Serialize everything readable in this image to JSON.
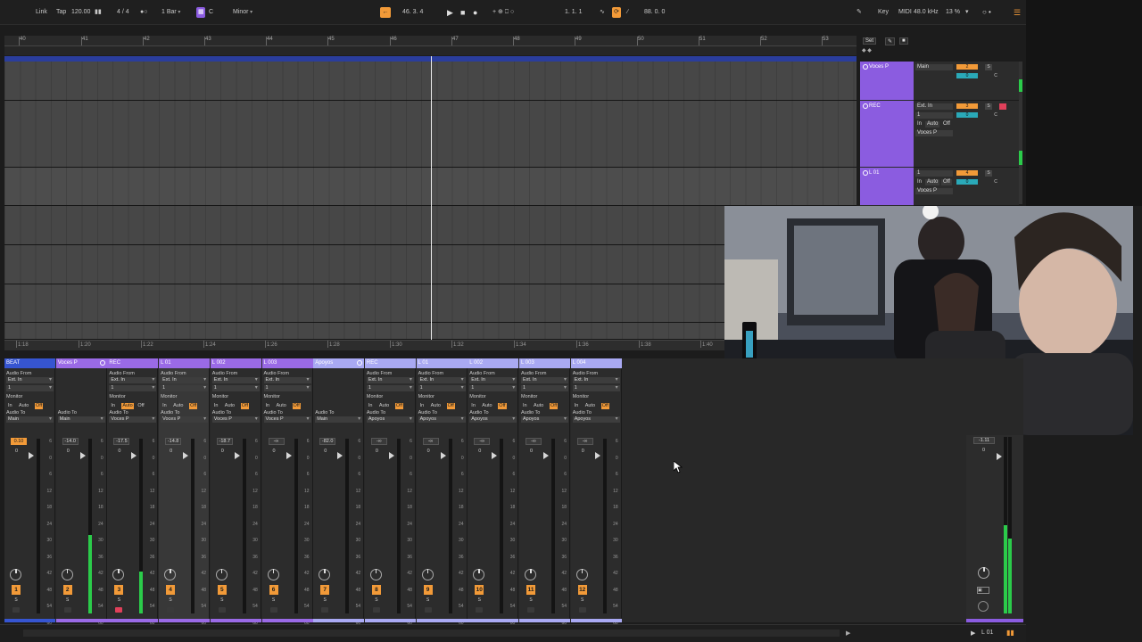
{
  "topbar": {
    "link": "Link",
    "tap": "Tap",
    "tempo": "120.00",
    "time_sig": "4 / 4",
    "quantize": "1 Bar",
    "key_root": "C",
    "scale": "Minor",
    "position": "46.  3.  4",
    "loop_start": "1.  1.  1",
    "loop_length": "88.  0.  0",
    "key_label": "Key",
    "midi_label": "MIDI",
    "sample_rate": "48.0 kHz",
    "cpu": "13 %"
  },
  "ruler": {
    "bars": [
      "40",
      "41",
      "42",
      "43",
      "44",
      "45",
      "46",
      "47",
      "48",
      "49",
      "50",
      "51",
      "52",
      "53"
    ]
  },
  "timeline": {
    "times": [
      "1:18",
      "1:20",
      "1:22",
      "1:24",
      "1:26",
      "1:28",
      "1:30",
      "1:32",
      "1:34",
      "1:36",
      "1:38",
      "1:40"
    ]
  },
  "arrangement": {
    "set_label": "Set",
    "tracks": [
      {
        "name": "Voces P",
        "input": "Main",
        "num": "2",
        "vol": "0",
        "s": "S",
        "c": "C"
      },
      {
        "name": "REC",
        "input": "Ext. In",
        "sub": "1",
        "monitor": [
          "In",
          "Auto",
          "Off"
        ],
        "out": "Voces P",
        "num": "3",
        "vol": "0",
        "s": "S",
        "c": "C"
      },
      {
        "name": "L 01",
        "input": "1",
        "monitor": [
          "In",
          "Auto",
          "Off"
        ],
        "out": "Voces P",
        "num": "4",
        "vol": "0",
        "s": "S",
        "c": "C"
      }
    ]
  },
  "mixer": {
    "labels": {
      "audio_from": "Audio From",
      "monitor": "Monitor",
      "audio_to": "Audio To",
      "in": "In",
      "auto": "Auto",
      "off": "Off",
      "s": "S"
    },
    "strips": [
      {
        "name": "BEAT",
        "color": "#3655d1",
        "from": "Ext. In",
        "ch": "1",
        "to": "Main",
        "vol": "0.10",
        "vol_hot": true,
        "pan": "0",
        "num": "1",
        "level": 0
      },
      {
        "name": "Voces P",
        "color": "#9a6ae6",
        "from": "",
        "ch": "",
        "to": "Main",
        "vol": "-14.0",
        "vol_hot": false,
        "pan": "0",
        "num": "2",
        "level": 0.45
      },
      {
        "name": "REC",
        "color": "#9a6ae6",
        "from": "Ext. In",
        "ch": "1",
        "to": "Voces P",
        "vol": "-17.5",
        "vol_hot": false,
        "pan": "0",
        "num": "3",
        "level": 0.24,
        "armed": true
      },
      {
        "name": "L 01",
        "color": "#9a6ae6",
        "from": "Ext. In",
        "ch": "1",
        "to": "Voces P",
        "vol": "-14.8",
        "vol_hot": false,
        "pan": "0",
        "num": "4",
        "level": 0,
        "selected": true
      },
      {
        "name": "L 002",
        "color": "#9a6ae6",
        "from": "Ext. In",
        "ch": "1",
        "to": "Voces P",
        "vol": "-18.7",
        "vol_hot": false,
        "pan": "0",
        "num": "5",
        "level": 0
      },
      {
        "name": "L 003",
        "color": "#9a6ae6",
        "from": "Ext. In",
        "ch": "1",
        "to": "Voces P",
        "vol": "-∞",
        "vol_hot": false,
        "pan": "0",
        "num": "6",
        "level": 0
      },
      {
        "name": "Apoyos",
        "color": "#a9a9f3",
        "from": "",
        "ch": "",
        "to": "Main",
        "vol": "-82.0",
        "vol_hot": false,
        "pan": "0",
        "num": "7",
        "level": 0
      },
      {
        "name": "REC",
        "color": "#a9a9f3",
        "from": "Ext. In",
        "ch": "1",
        "to": "Apoyos",
        "vol": "-∞",
        "vol_hot": false,
        "pan": "0",
        "num": "8",
        "level": 0
      },
      {
        "name": "L 01",
        "color": "#a9a9f3",
        "from": "Ext. In",
        "ch": "1",
        "to": "Apoyos",
        "vol": "-∞",
        "vol_hot": false,
        "pan": "0",
        "num": "9",
        "level": 0
      },
      {
        "name": "L 002",
        "color": "#a9a9f3",
        "from": "Ext. In",
        "ch": "1",
        "to": "Apoyos",
        "vol": "-∞",
        "vol_hot": false,
        "pan": "0",
        "num": "10",
        "level": 0
      },
      {
        "name": "L 003",
        "color": "#a9a9f3",
        "from": "Ext. In",
        "ch": "1",
        "to": "Apoyos",
        "vol": "-∞",
        "vol_hot": false,
        "pan": "0",
        "num": "11",
        "level": 0
      },
      {
        "name": "L 004",
        "color": "#a9a9f3",
        "from": "Ext. In",
        "ch": "1",
        "to": "Apoyos",
        "vol": "-∞",
        "vol_hot": false,
        "pan": "0",
        "num": "12",
        "level": 0
      }
    ],
    "scale": [
      "6",
      "0",
      "6",
      "12",
      "18",
      "24",
      "30",
      "36",
      "42",
      "48",
      "54",
      "60"
    ],
    "master": {
      "vol": "-1.11",
      "pan": "0",
      "level": 0.5
    }
  },
  "statusbar": {
    "track_label": "L 01"
  }
}
